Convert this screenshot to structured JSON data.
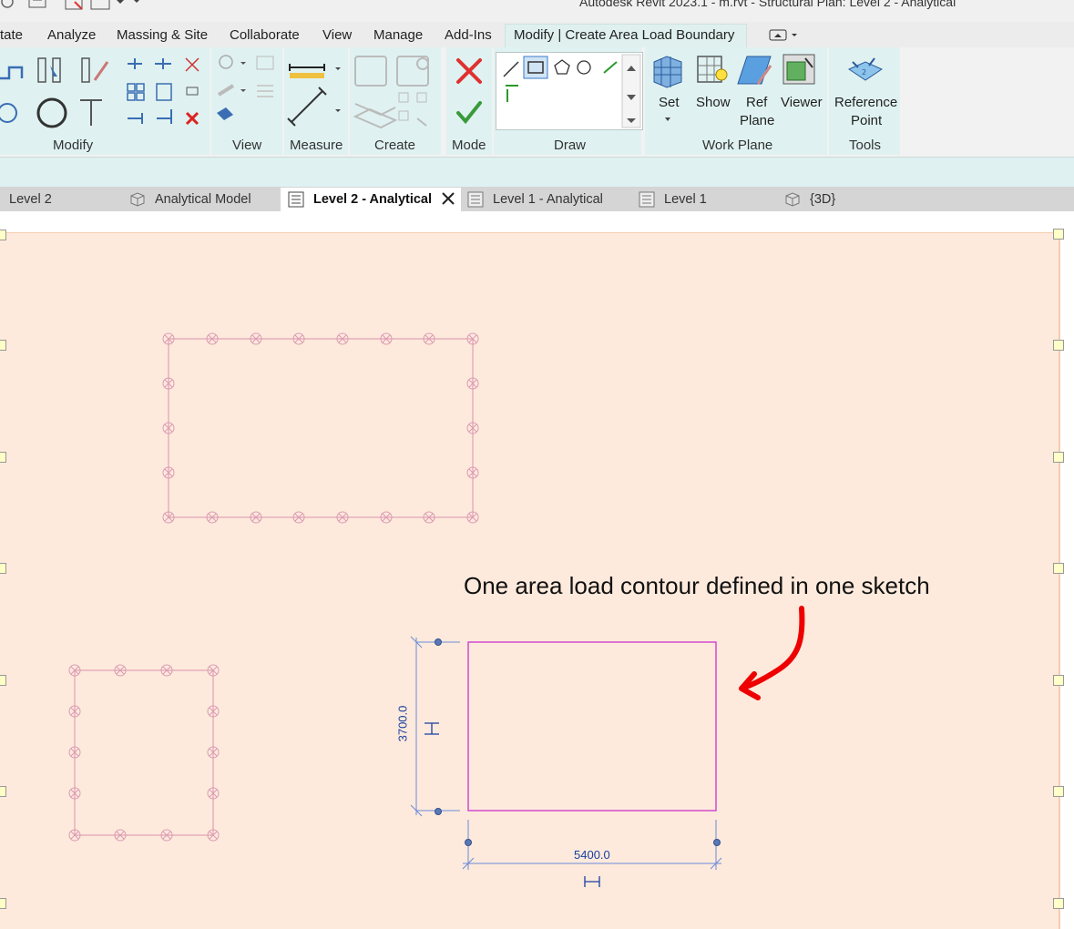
{
  "app": {
    "title": "Autodesk Revit 2023.1 - m.rvt - Structural Plan: Level 2 - Analytical"
  },
  "ribbon_tabs": [
    {
      "label": "tate"
    },
    {
      "label": "Analyze"
    },
    {
      "label": "Massing & Site"
    },
    {
      "label": "Collaborate"
    },
    {
      "label": "View"
    },
    {
      "label": "Manage"
    },
    {
      "label": "Add-Ins"
    },
    {
      "label": "Modify | Create Area Load Boundary"
    }
  ],
  "ribbon": {
    "panels": {
      "modify": "Modify",
      "view": "View",
      "measure": "Measure",
      "create": "Create",
      "mode": "Mode",
      "draw": "Draw",
      "work_plane": "Work Plane",
      "tools": "Tools"
    },
    "work_plane_buttons": {
      "set": "Set",
      "show": "Show",
      "ref_plane_1": "Ref",
      "ref_plane_2": "Plane",
      "viewer": "Viewer"
    },
    "tools_buttons": {
      "reference_point_1": "Reference",
      "reference_point_2": "Point"
    }
  },
  "view_tabs": [
    {
      "label": "Level 2",
      "icon": "plan-view-icon"
    },
    {
      "label": "Analytical Model",
      "icon": "3d-view-icon"
    },
    {
      "label": "Level 2 - Analytical",
      "icon": "plan-view-icon",
      "active": true
    },
    {
      "label": "Level 1 - Analytical",
      "icon": "plan-view-icon"
    },
    {
      "label": "Level 1",
      "icon": "plan-view-icon"
    },
    {
      "label": "{3D}",
      "icon": "3d-view-icon"
    }
  ],
  "canvas": {
    "annotation": "One area load contour defined in one sketch",
    "dimension_vertical": "3700.0",
    "dimension_horizontal": "5400.0"
  },
  "colors": {
    "area_fill": "#fdeadc",
    "sketch_line": "#cc33cc",
    "dimension": "#1a3fa0",
    "arrow": "#ee0000",
    "ribbon_panel": "#dff2f1"
  }
}
